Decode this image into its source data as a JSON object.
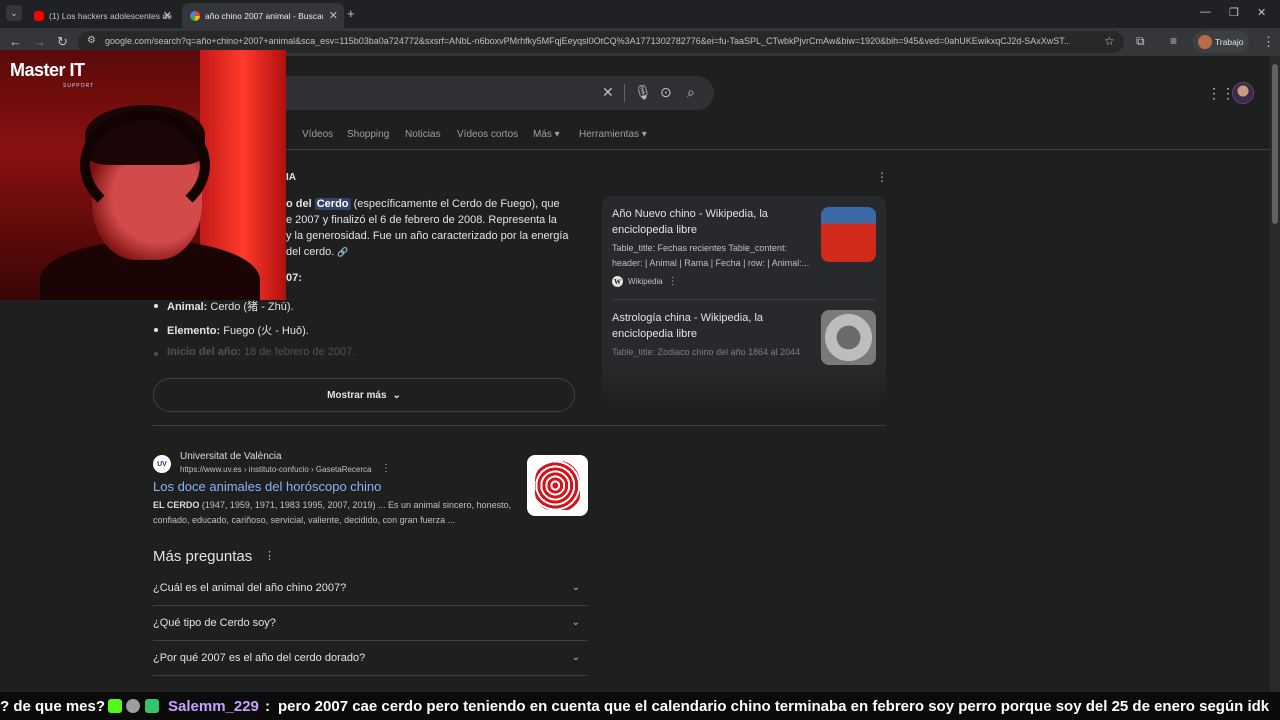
{
  "browser": {
    "tabs": [
      {
        "label": "(1) Los hackers adolescentes de",
        "favicon_color": "#ff0000",
        "active": false
      },
      {
        "label": "año chino 2007 animal - Buscar",
        "favicon_color": "#e8eaed",
        "active": true
      }
    ],
    "new_tab": "+",
    "url": "google.com/search?q=año+chino+2007+animal&sca_esv=115b03ba0a724772&sxsrf=ANbL-n6boxvPMrhfky5MFqjEeyqsl0OtCQ%3A1771302782776&ei=fu-TaaSPL_CTwbkPjvrCmAw&biw=1920&bih=945&ved=0ahUKEwikxqCJ2d-SAxXwST...",
    "profile_label": "Trabajo"
  },
  "search": {
    "filters": [
      "Vídeos",
      "Shopping",
      "Noticias",
      "Vídeos cortos",
      "Más ▾",
      "Herramientas ▾"
    ]
  },
  "overview": {
    "heading_fragment": "IA",
    "line1_pre": "o del",
    "line1_hl": "Cerdo",
    "line1_post": "(específicamente el Cerdo de Fuego), que",
    "line2": "e 2007 y finalizó el 6 de febrero de 2008. Representa la",
    "line3": "y la generosidad. Fue un año caracterizado por la energía",
    "line4": "del cerdo.",
    "sub_heading": "07:",
    "bullets": [
      {
        "key": "Animal:",
        "value": "Cerdo (猪 - Zhū)."
      },
      {
        "key": "Elemento:",
        "value": "Fuego (火 - Huǒ)."
      },
      {
        "key": "Inicio del año:",
        "value": "18 de febrero de 2007."
      }
    ],
    "show_more": "Mostrar más"
  },
  "side_cards": [
    {
      "title": "Año Nuevo chino - Wikipedia, la enciclopedia libre",
      "snippet": "Table_title: Fechas recientes Table_content: header: | Animal | Rama | Fecha | row: | Animal:...",
      "source": "Wikipedia"
    },
    {
      "title": "Astrología china - Wikipedia, la enciclopedia libre",
      "snippet": "Table_title: Zodiaco chino del año 1864 al 2044"
    }
  ],
  "result": {
    "logo_text": "UV",
    "site": "Universitat de València",
    "url": "https://www.uv.es › instituto-confucio › GasetaRecerca",
    "title": "Los doce animales del horóscopo chino",
    "snippet_bold": "EL CERDO",
    "snippet": "(1947, 1959, 1971, 1983 1995, 2007, 2019) ... Es un animal sincero, honesto, confiado, educado, cariñoso, servicial, valiente, decidido, con gran fuerza ..."
  },
  "people_also_ask": {
    "title": "Más preguntas",
    "items": [
      "¿Cuál es el animal del año chino 2007?",
      "¿Qué tipo de Cerdo soy?",
      "¿Por qué 2007 es el año del cerdo dorado?"
    ]
  },
  "overlay": {
    "logo": "Master IT",
    "logo_sub": "SUPPORT"
  },
  "chat": {
    "prev_tail": "? de que mes?",
    "username": "Salemm_229",
    "separator": ":",
    "message": "pero 2007 cae cerdo pero teniendo en cuenta que el calendario chino terminaba en febrero soy perro porque soy del 25 de enero  según idk"
  },
  "colors": {
    "background": "#1f1f1f",
    "link": "#8ab4f8",
    "highlight": "#314467",
    "chat_user": "#c9a0ff"
  }
}
